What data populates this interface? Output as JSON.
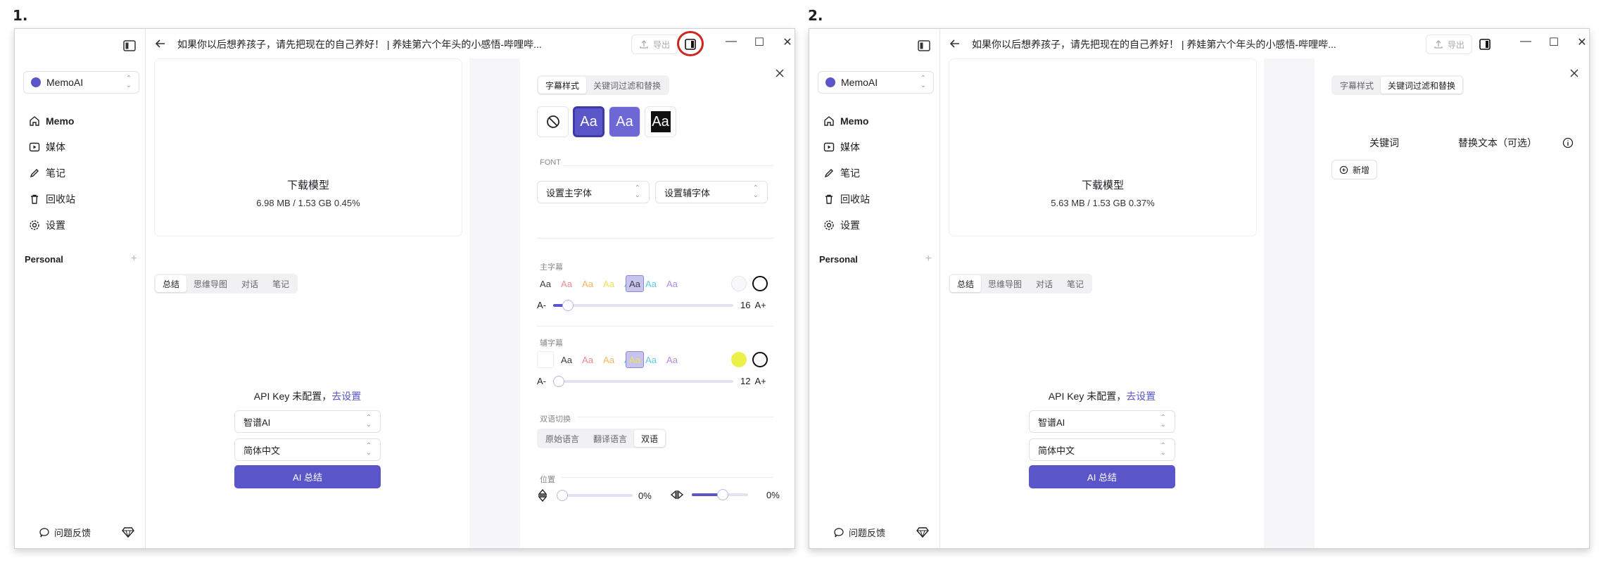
{
  "step_labels": [
    "1.",
    "2."
  ],
  "app": {
    "title": "如果你以后想养孩子，请先把现在的自己养好！ | 养娃第六个年头的小感悟-哔哩哔...",
    "export_label": "导出",
    "workspace": "MemoAI",
    "nav": [
      "Memo",
      "媒体",
      "笔记",
      "回收站",
      "设置"
    ],
    "personal": "Personal",
    "feedback": "问题反馈",
    "main_tabs": [
      "总结",
      "思维导图",
      "对话",
      "笔记"
    ],
    "api_prefix": "API Key 未配置，",
    "api_link": "去设置",
    "model_select": "智谱AI",
    "lang_select": "简体中文",
    "ai_button": "AI 总结",
    "download_title": "下载模型"
  },
  "window1": {
    "download_progress": "6.98 MB / 1.53 GB 0.45%",
    "panel_tabs": [
      "字幕样式",
      "关键词过滤和替换"
    ],
    "preset_text": "Aa",
    "font_label": "FONT",
    "font_main": "设置主字体",
    "font_sub": "设置辅字体",
    "main_sub_label": "主字幕",
    "sub_sub_label": "辅字幕",
    "sample": "Aa",
    "main_size": "16",
    "sub_size": "12",
    "size_small": "A-",
    "size_big": "A+",
    "bilingual_label": "双语切换",
    "bilingual_tabs": [
      "原始语言",
      "翻译语言",
      "双语"
    ],
    "position_label": "位置",
    "v_pos": "0%",
    "h_pos": "0%",
    "main_size_value": 16,
    "sub_size_value": 12,
    "v_pos_value": 0,
    "h_pos_value": 0
  },
  "window2": {
    "download_progress": "5.63 MB / 1.53 GB 0.37%",
    "panel_tabs": [
      "字幕样式",
      "关键词过滤和替换"
    ],
    "kw_col": "关键词",
    "replace_col": "替换文本（可选）",
    "add_label": "新增"
  },
  "colors": {
    "accent": "#5a55c8",
    "highlight": "#d0251f",
    "main_swatches": [
      "#3d3d46",
      "#3d3d46",
      "#f08a8a",
      "#f4b65e",
      "#f2e15a",
      "#5fd3a6",
      "#5ec8e8",
      "#b88ae6"
    ],
    "sub_swatches": [
      "transparent",
      "#3d3d46",
      "#f08a8a",
      "#f4b65e",
      "#f2e15a",
      "#5fd3a6",
      "#5ec8e8",
      "#b88ae6"
    ],
    "sub_color_dot": "#eef04a"
  }
}
